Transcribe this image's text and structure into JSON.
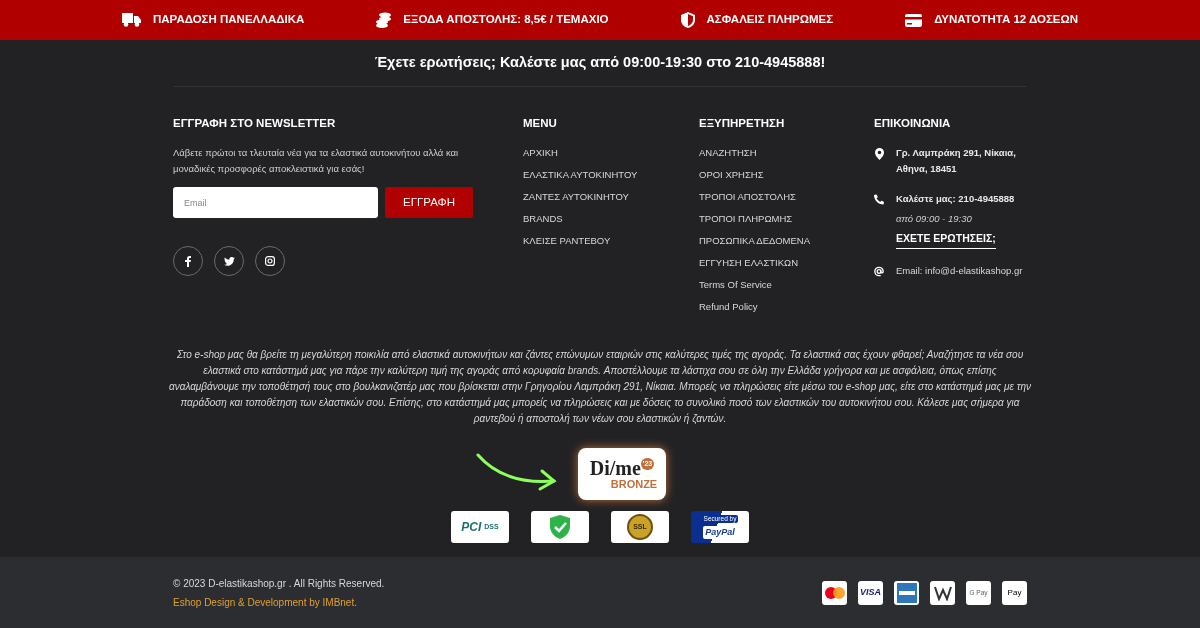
{
  "top_bar": [
    {
      "kind": "truck",
      "label": "ΠΑΡΑΔΟΣΗ ΠΑΝΕΛΛΑΔΙΚΑ"
    },
    {
      "kind": "coins",
      "label": "ΕΞΟΔΑ ΑΠΟΣΤΟΛΗΣ: 8,5€ / ΤΕΜΑΧΙΟ"
    },
    {
      "kind": "shield",
      "label": "ΑΣΦΑΛΕΙΣ ΠΛΗΡΩΜΕΣ"
    },
    {
      "kind": "card",
      "label": "ΔΥΝΑΤΟΤΗΤΑ 12 ΔΟΣΕΩΝ"
    }
  ],
  "hotline": "Έχετε ερωτήσεις; Καλέστε μας από 09:00-19:30 στο 210-4945888!",
  "newsletter": {
    "title": "ΕΓΓΡΑΦΗ ΣΤΟ NEWSLETTER",
    "text": "Λάβετε πρώτοι τα τλευταία νέα για τα ελαστικά αυτοκινήτου αλλά και μοναδικές προσφορές αποκλειστικά για εσάς!",
    "placeholder": "Email",
    "button": "ΕΓΓΡΑΦΗ",
    "social": [
      {
        "kind": "facebook"
      },
      {
        "kind": "twitter"
      },
      {
        "kind": "instagram"
      }
    ]
  },
  "menu": {
    "title": "MENU",
    "items": [
      "ΑΡΧΙΚΗ",
      "ΕΛΑΣΤΙΚΑ ΑΥΤΟΚΙΝΗΤΟΥ",
      "ΖΑΝΤΕΣ ΑΥΤΟΚΙΝΗΤΟΥ",
      "BRANDS",
      "ΚΛΕΙΣΕ ΡΑΝΤΕΒΟΥ"
    ]
  },
  "service": {
    "title": "ΕΞΥΠΗΡΕΤΗΣΗ",
    "items": [
      "ΑΝΑΖΗΤΗΣΗ",
      "ΟΡΟΙ ΧΡΗΣΗΣ",
      "ΤΡΟΠΟΙ ΑΠΟΣΤΟΛΗΣ",
      "ΤΡΟΠΟΙ ΠΛΗΡΩΜΗΣ",
      "ΠΡΟΣΩΠΙΚΑ ΔΕΔΟΜΕΝΑ",
      "ΕΓΓΥΗΣΗ ΕΛΑΣΤΙΚΩΝ",
      "Terms Of Service",
      "Refund Policy"
    ]
  },
  "contact": {
    "title": "ΕΠΙΚΟΙΝΩΝΙΑ",
    "items": [
      {
        "kind": "address",
        "text": "Γρ. Λαμπράκη 291, Νίκαια, Αθηνα, 18451"
      },
      {
        "kind": "phone",
        "text": "Καλέστε μας: 210-4945888",
        "hours": "από 09:00 - 19:30",
        "link": "ΕΧΕΤΕ ΕΡΩΤΗΣΕΙΣ;"
      },
      {
        "kind": "email",
        "text": "Email: info@d-elastikashop.gr"
      }
    ]
  },
  "about": "Στο e-shop μας θα βρείτε τη μεγαλύτερη ποικιλία από ελαστικά αυτοκινήτων και ζάντες επώνυμων εταιριών στις καλύτερες τιμές της αγοράς. Τα ελαστικά σας έχουν φθαρεί; Αναζήτησε τα νέα σου ελαστικά στο κατάστημά μας για πάρε την καλύτερη τιμή της αγοράς από κορυφαία brands. Αποστέλλουμε τα λάστιχα σου σε όλη την Ελλάδα γρήγορα και με ασφάλεια, όπως επίσης αναλαμβάνουμε την τοποθέτησή τους στο βουλκανιζατέρ μας που βρίσκεται στην Γρηγορίου Λαμπράκη 291, Νίκαια. Μπορείς να πληρώσεις είτε μέσω του e-shop μας, είτε στο κατάστημά μας με την παράδοση και τοποθέτηση των ελαστικών σου. Επίσης, στο κατάστημά μας μπορείς να πληρώσεις και με δόσεις το συνολικό ποσό των ελαστικών του αυτοκινήτου σου. Κάλεσε μας σήμερα για ραντεβού ή αποστολή των νέων σου ελαστικών ή ζαντών.",
  "award": {
    "name": "Di/me",
    "year": "'23",
    "level": "BRONZE"
  },
  "trust_badges": [
    {
      "kind": "pci",
      "texts": [
        "PCI",
        "DSS"
      ]
    },
    {
      "kind": "shield"
    },
    {
      "kind": "ssl",
      "texts": [
        "SSL"
      ]
    },
    {
      "kind": "paypal",
      "texts": [
        "Secured by",
        "PayPal"
      ]
    }
  ],
  "footer": {
    "copyright": "© 2023 D-elastikashop.gr . All Rights Reserved.",
    "credit": "Eshop Design & Development by IMBnet.",
    "payment_methods": [
      {
        "kind": "mastercard"
      },
      {
        "kind": "visa",
        "label": "VISA"
      },
      {
        "kind": "amex"
      },
      {
        "kind": "generic"
      },
      {
        "kind": "gpay",
        "label": "G Pay"
      },
      {
        "kind": "applepay",
        "label": "Pay"
      }
    ]
  }
}
